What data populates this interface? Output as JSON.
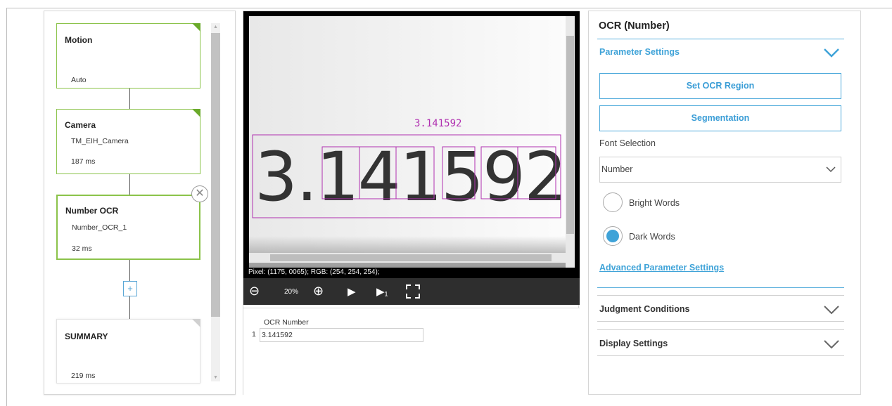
{
  "flow": {
    "nodes": [
      {
        "title": "Motion",
        "sub": "",
        "time": "Auto"
      },
      {
        "title": "Camera",
        "sub": "TM_EIH_Camera",
        "time": "187 ms"
      },
      {
        "title": "Number OCR",
        "sub": "Number_OCR_1",
        "time": "32 ms"
      },
      {
        "title": "SUMMARY",
        "sub": "",
        "time": "219 ms"
      }
    ],
    "icons": {
      "close": "close-circle-icon",
      "add": "add-node-icon"
    }
  },
  "viewer": {
    "ocr_overlay_label": "3.141592",
    "image_text": "3.141592",
    "status": "Pixel: (1175, 0065); RGB: (254, 254, 254);",
    "zoom": "20%",
    "toolbar_icons": [
      "zoom-out-icon",
      "zoom-in-icon",
      "play-icon",
      "step-icon",
      "fit-screen-icon"
    ],
    "overlay_color": "#b030b0"
  },
  "result": {
    "header": "OCR Number",
    "rows": [
      {
        "index": "1",
        "value": "3.141592"
      }
    ]
  },
  "settings": {
    "title": "OCR (Number)",
    "parameter_settings": "Parameter Settings",
    "set_region": "Set OCR Region",
    "segmentation": "Segmentation",
    "font_selection_label": "Font Selection",
    "font_selection_value": "Number",
    "bright_words": "Bright Words",
    "dark_words": "Dark Words",
    "selected_mode": "Dark Words",
    "advanced": "Advanced Parameter Settings",
    "judgment": "Judgment Conditions",
    "display": "Display Settings",
    "accent_color": "#3fa3d8"
  }
}
